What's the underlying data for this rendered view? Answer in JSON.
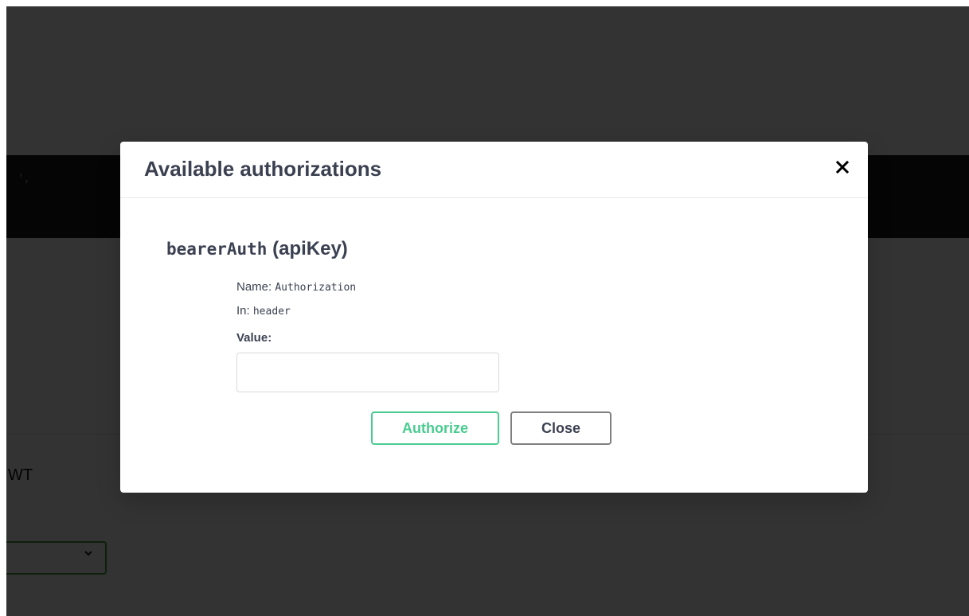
{
  "background": {
    "code_fragment": "',",
    "text_fragment": "WT",
    "select_chevron_icon": "chevron-down-icon"
  },
  "modal": {
    "title": "Available authorizations",
    "close_icon": "close-icon",
    "scheme": {
      "name": "bearerAuth",
      "type": "(apiKey)",
      "name_label": "Name:",
      "name_value": "Authorization",
      "in_label": "In:",
      "in_value": "header",
      "value_label": "Value:",
      "value_input": "",
      "value_placeholder": ""
    },
    "buttons": {
      "authorize_label": "Authorize",
      "close_label": "Close"
    }
  },
  "colors": {
    "authorize_accent": "#49cc90",
    "text_primary": "#3b4151",
    "close_border": "#808080",
    "select_border": "#41a13c"
  }
}
